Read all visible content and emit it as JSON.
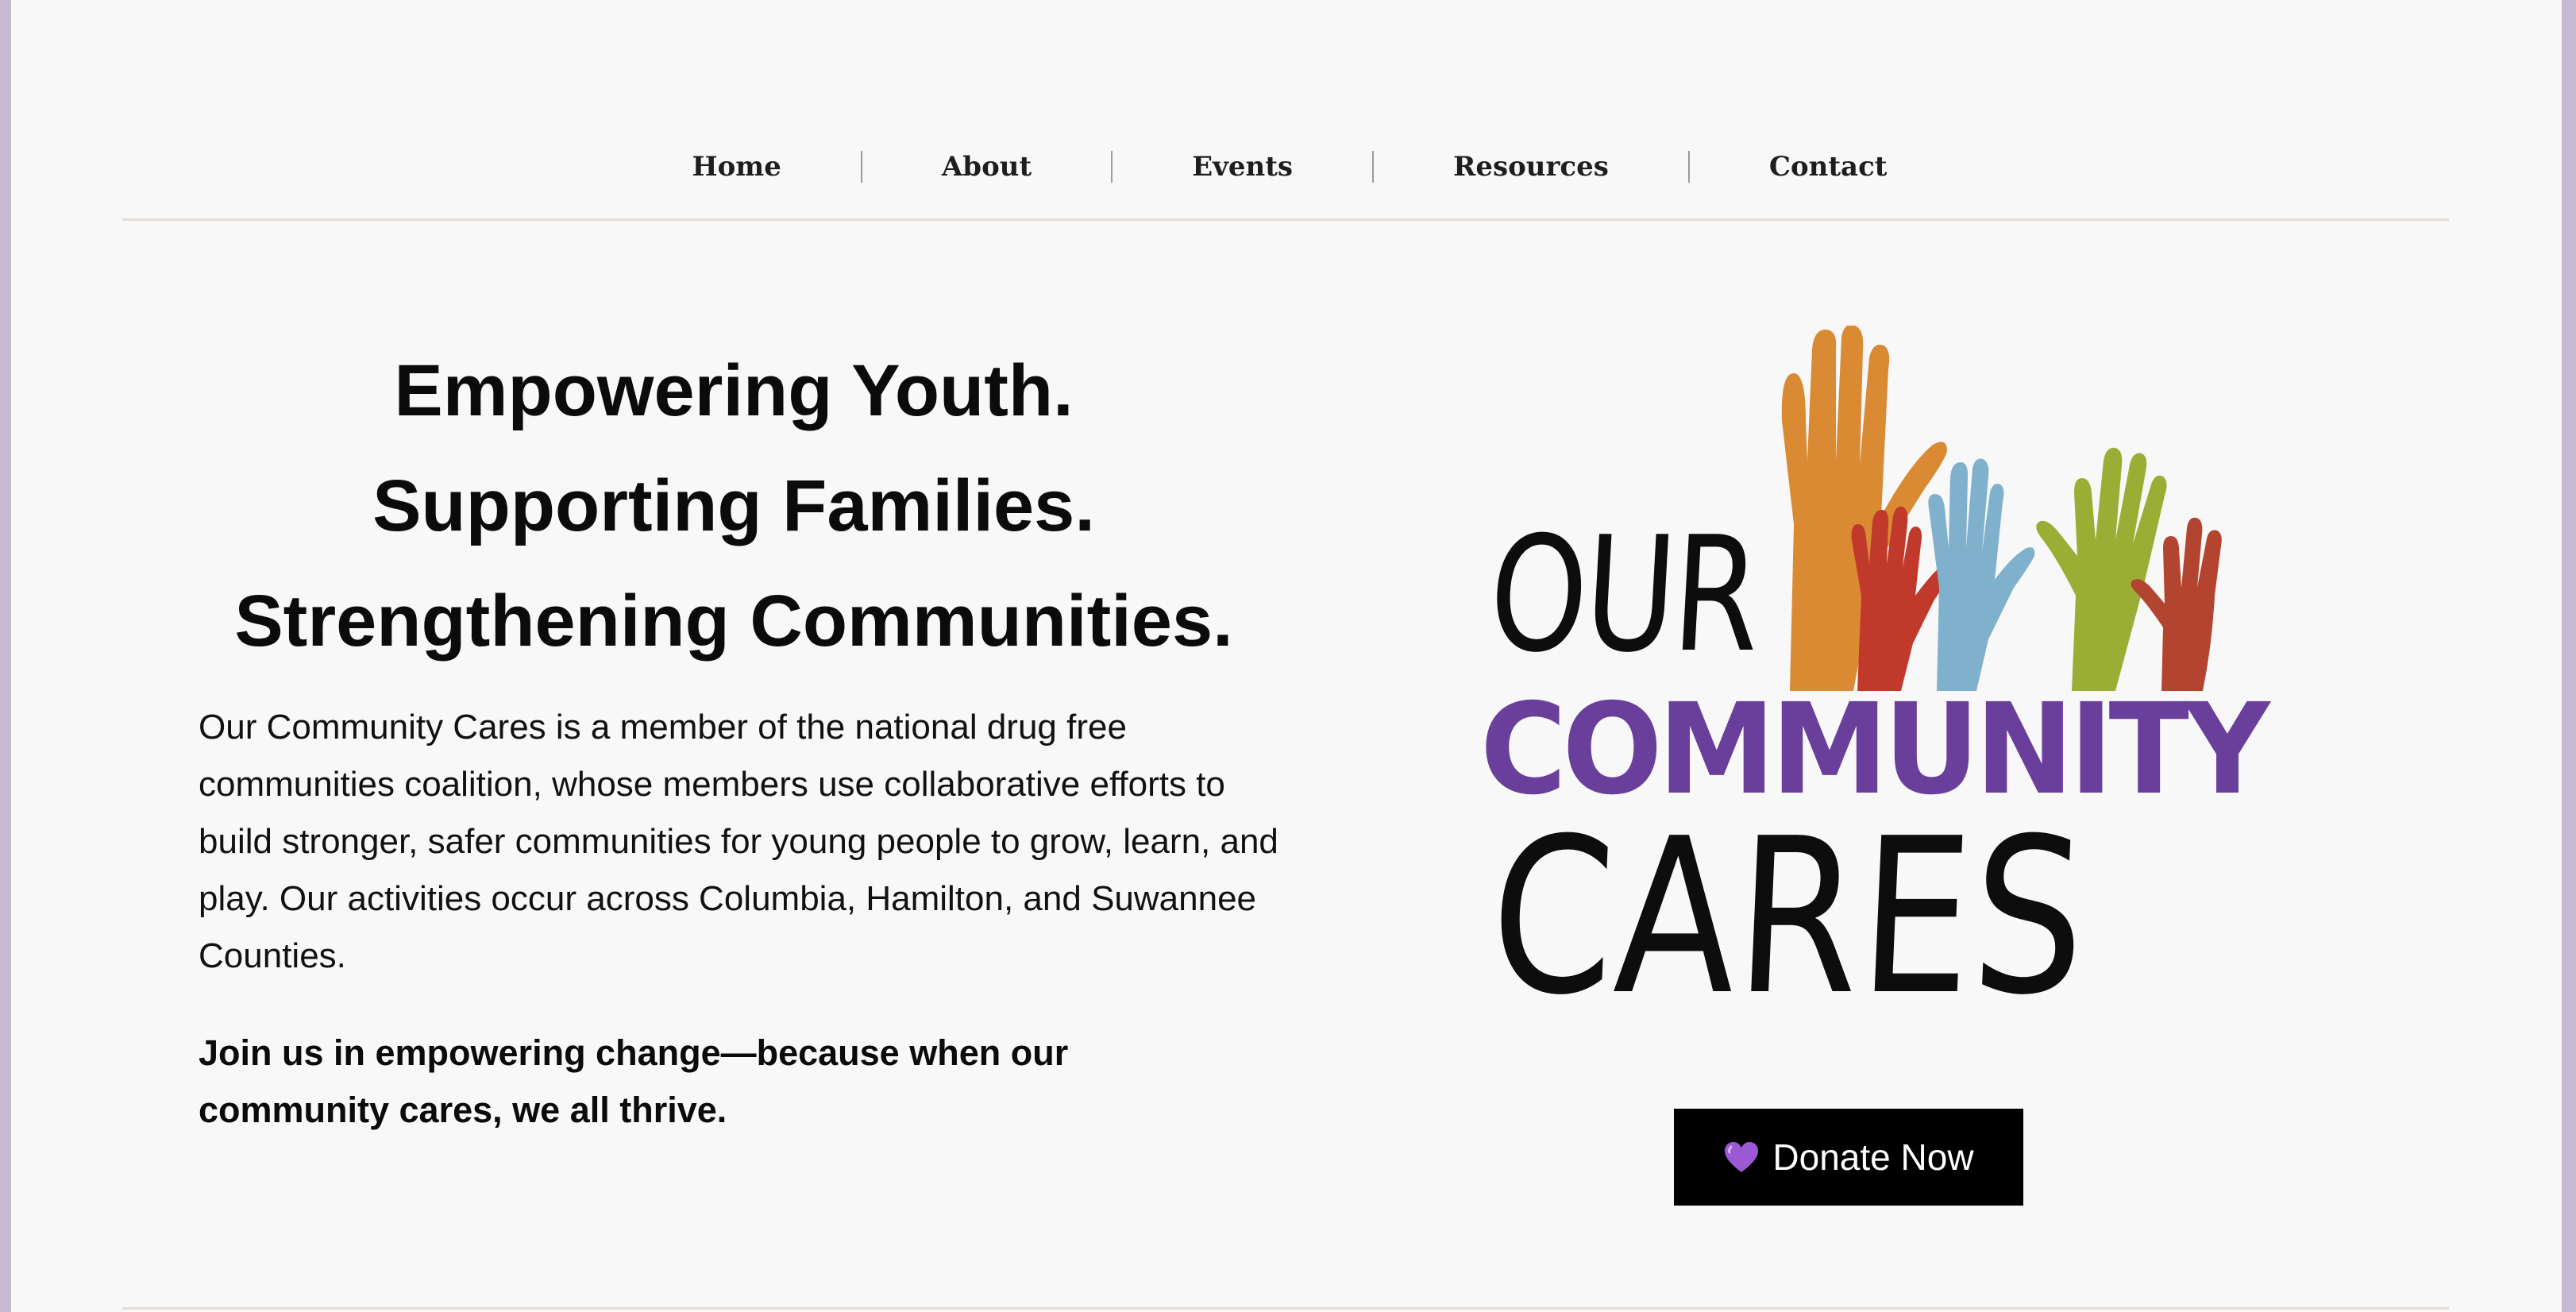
{
  "nav": {
    "items": [
      {
        "label": "Home"
      },
      {
        "label": "About"
      },
      {
        "label": "Events"
      },
      {
        "label": "Resources"
      },
      {
        "label": "Contact"
      }
    ]
  },
  "hero": {
    "headline": [
      "Empowering Youth.",
      "Supporting Families.",
      "Strengthening Communities."
    ],
    "intro": "Our Community Cares is a member of the national drug free communities coalition, whose members use collaborative efforts to build stronger, safer communities for young people to grow, learn, and play. Our activities occur across Columbia, Hamilton, and Suwannee Counties.",
    "cta": "Join us in empowering change—because when our community cares, we all thrive."
  },
  "logo": {
    "line1": "OUR",
    "line2": "COMMUNITY",
    "line3": "CARES",
    "colors": {
      "purple": "#6a3f9c",
      "orange_hand": "#d98a33",
      "red_hand": "#c0392b",
      "blue_hand": "#7fb0cc",
      "green_hand": "#9aae35",
      "rust_hand": "#b34430"
    }
  },
  "donate": {
    "icon": "purple-heart-icon",
    "label": "Donate Now"
  },
  "colors": {
    "page_bg": "#f8f8f8",
    "frame": "#c7bbd4",
    "rule": "#e5ddd7",
    "button_bg": "#000000"
  }
}
